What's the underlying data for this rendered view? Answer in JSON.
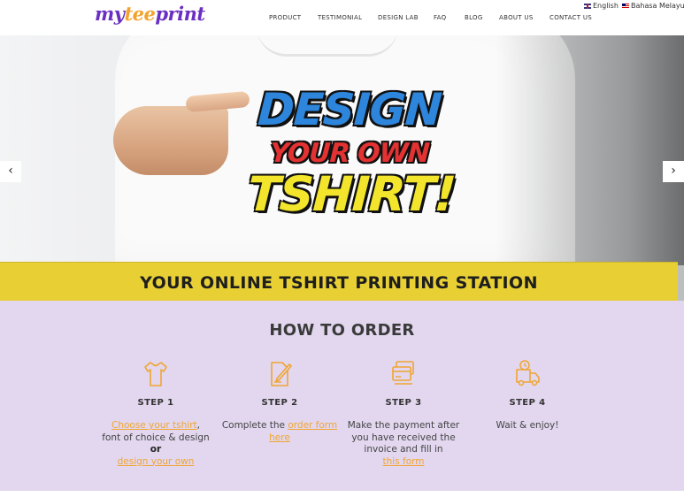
{
  "header": {
    "logo": {
      "part1": "my",
      "part2": "tee",
      "part3": "print"
    },
    "nav": [
      "PRODUCT",
      "TESTIMONIAL",
      "DESIGN LAB",
      "FAQ",
      "BLOG",
      "ABOUT US",
      "CONTACT US"
    ],
    "languages": [
      "English",
      "Bahasa Melayu"
    ]
  },
  "hero": {
    "line1": "DESIGN",
    "line2": "YOUR OWN",
    "line3": "TSHIRT!",
    "banner": "YOUR ONLINE TSHIRT PRINTING STATION",
    "prev_icon": "‹",
    "next_icon": "›"
  },
  "order": {
    "title": "HOW TO ORDER",
    "steps": [
      {
        "icon": "tshirt-icon",
        "title": "STEP 1",
        "link1": "Choose your tshirt",
        "text1": ",",
        "text2": "font of choice & design",
        "or": "or",
        "link2": "design your own"
      },
      {
        "icon": "edit-icon",
        "title": "STEP 2",
        "text1": "Complete the ",
        "link1": "order form here"
      },
      {
        "icon": "payment-card-icon",
        "title": "STEP 3",
        "text1": "Make the payment after you have received the invoice and fill in",
        "link1": "this form"
      },
      {
        "icon": "delivery-truck-icon",
        "title": "STEP 4",
        "text1": "Wait & enjoy!"
      }
    ]
  },
  "colors": {
    "brand_purple": "#6a2fc2",
    "brand_orange": "#f4a22d",
    "banner_yellow": "#e7cf34",
    "order_bg": "#e2d7ef",
    "link_orange": "#f0a530"
  }
}
